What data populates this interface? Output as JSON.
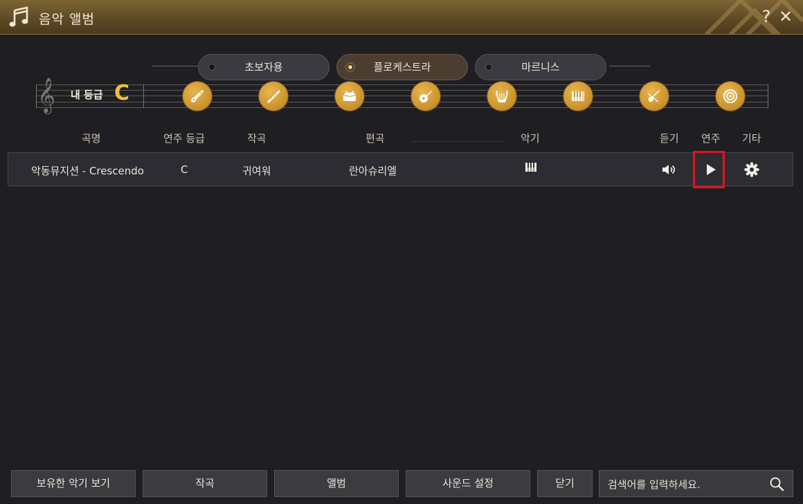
{
  "window": {
    "title": "음악 앨범",
    "help": "?",
    "close": "✕"
  },
  "tabs": [
    {
      "label": "초보자용",
      "active": false
    },
    {
      "label": "플로케스트라",
      "active": true
    },
    {
      "label": "마르니스",
      "active": false
    }
  ],
  "grade": {
    "label": "내 등급",
    "value": "C"
  },
  "instruments": [
    {
      "icon": "guitar-icon"
    },
    {
      "icon": "flute-icon"
    },
    {
      "icon": "drum-icon"
    },
    {
      "icon": "lute-icon"
    },
    {
      "icon": "lyre-icon"
    },
    {
      "icon": "piano-icon"
    },
    {
      "icon": "violin-icon"
    },
    {
      "icon": "drum-pad-icon"
    }
  ],
  "table": {
    "headers": {
      "song": "곡명",
      "grade": "연주 등급",
      "composer": "작곡",
      "arranger": "편곡",
      "instrument": "악기",
      "listen": "듣기",
      "play": "연주",
      "etc": "기타"
    },
    "rows": [
      {
        "song": "악동뮤지션 - Crescendo",
        "grade": "C",
        "composer": "귀여워",
        "arranger": "란아슈리엘",
        "instrument_icon": "piano-icon"
      }
    ]
  },
  "footer": {
    "owned_instruments": "보유한 악기 보기",
    "compose": "작곡",
    "album": "앨범",
    "sound_settings": "사운드 설정",
    "close": "닫기",
    "search_placeholder": "검색어를 입력하세요."
  },
  "colors": {
    "accent": "#f0bf3a",
    "highlight": "#e3131e",
    "gold": "#c8902a"
  }
}
